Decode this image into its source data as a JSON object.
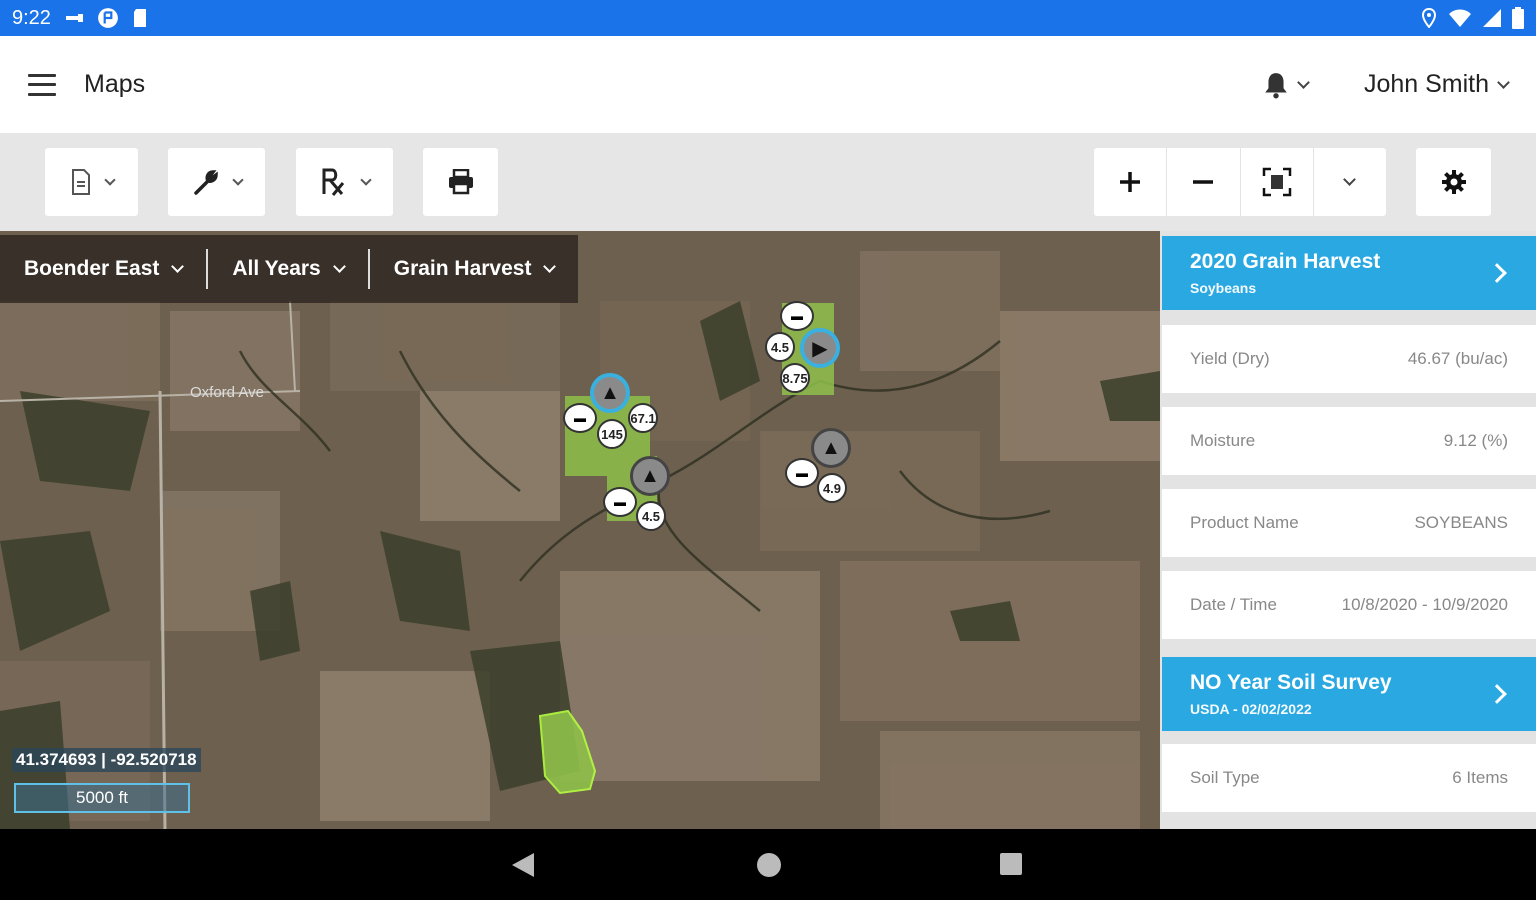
{
  "status_bar": {
    "time": "9:22",
    "left_icons": [
      "usb-icon",
      "flag-icon",
      "sd-card-icon"
    ],
    "right_icons": [
      "location-icon",
      "wifi-icon",
      "signal-icon",
      "battery-icon"
    ]
  },
  "app_bar": {
    "title": "Maps",
    "user_name": "John Smith"
  },
  "toolbar": {
    "buttons": [
      "document-icon",
      "wrench-icon",
      "prescription-icon",
      "print-icon"
    ],
    "zoom": [
      "zoom-in-icon",
      "zoom-out-icon",
      "fit-extent-icon",
      "more-icon"
    ],
    "settings": "gear-icon"
  },
  "map": {
    "filters": {
      "farm": "Boender East",
      "years": "All Years",
      "layer": "Grain Harvest"
    },
    "road_label": "Oxford Ave",
    "coordinates": "41.374693 | -92.520718",
    "scale": "5000 ft",
    "markers": {
      "m1": "67.1",
      "m2": "145",
      "m3": "4.5",
      "m4": "4.5",
      "m5": "8.75",
      "m6": "4.9"
    }
  },
  "panel": {
    "card1": {
      "title": "2020 Grain Harvest",
      "subtitle": "Soybeans",
      "rows": [
        {
          "label": "Yield (Dry)",
          "value": "46.67 (bu/ac)"
        },
        {
          "label": "Moisture",
          "value": "9.12 (%)"
        },
        {
          "label": "Product Name",
          "value": "SOYBEANS"
        },
        {
          "label": "Date / Time",
          "value": "10/8/2020 - 10/9/2020"
        }
      ]
    },
    "card2": {
      "title": "NO Year Soil Survey",
      "subtitle": "USDA - 02/02/2022",
      "rows": [
        {
          "label": "Soil Type",
          "value": "6 Items"
        }
      ]
    }
  },
  "colors": {
    "status_bar": "#1a73e8",
    "accent": "#2aa8e2",
    "field_green": "#8fc04a"
  }
}
